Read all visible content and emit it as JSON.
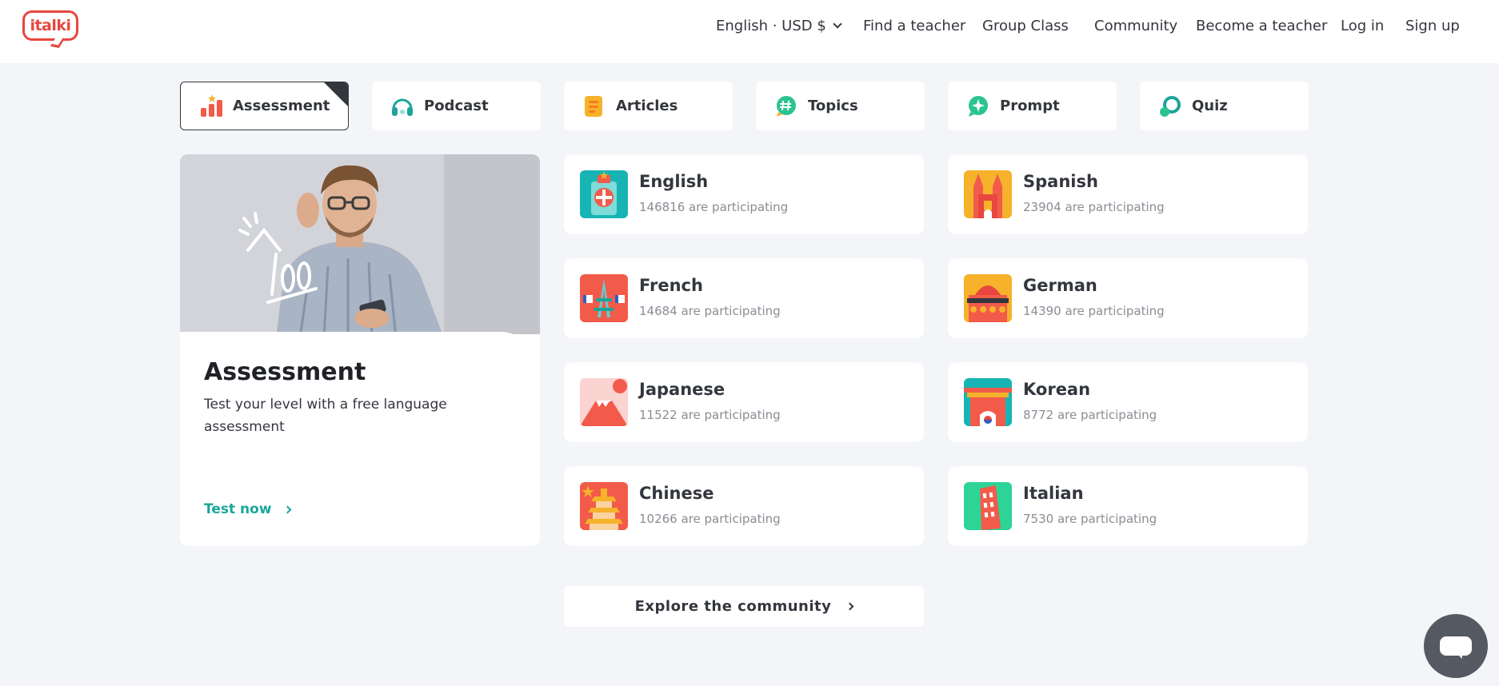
{
  "header": {
    "logo_text": "italki",
    "nav": [
      {
        "label": "English · USD $"
      },
      {
        "label": "Find a teacher"
      },
      {
        "label": "Group Class"
      },
      {
        "label": "Community"
      },
      {
        "label": "Become a teacher"
      },
      {
        "label": "Log in"
      },
      {
        "label": "Sign up"
      }
    ]
  },
  "tabs": [
    {
      "label": "Assessment",
      "icon": "bar-chart-icon",
      "active": true
    },
    {
      "label": "Podcast",
      "icon": "headphones-icon",
      "active": false
    },
    {
      "label": "Articles",
      "icon": "article-icon",
      "active": false
    },
    {
      "label": "Topics",
      "icon": "hashtag-icon",
      "active": false
    },
    {
      "label": "Prompt",
      "icon": "sparkle-icon",
      "active": false
    },
    {
      "label": "Quiz",
      "icon": "quiz-icon",
      "active": false
    }
  ],
  "assessment": {
    "title": "Assessment",
    "description": "Test your level with a free language assessment",
    "cta": "Test now"
  },
  "languages": [
    {
      "name": "English",
      "count": "146816 are participating"
    },
    {
      "name": "Spanish",
      "count": "23904 are participating"
    },
    {
      "name": "French",
      "count": "14684 are participating"
    },
    {
      "name": "German",
      "count": "14390 are participating"
    },
    {
      "name": "Japanese",
      "count": "11522 are participating"
    },
    {
      "name": "Korean",
      "count": "8772 are participating"
    },
    {
      "name": "Chinese",
      "count": "10266 are participating"
    },
    {
      "name": "Italian",
      "count": "7530 are participating"
    }
  ],
  "explore": {
    "label": "Explore the community"
  },
  "colors": {
    "brand": "#e8463f",
    "accent": "#1aa69a",
    "text": "#33363d",
    "background": "#f4f5f8"
  }
}
